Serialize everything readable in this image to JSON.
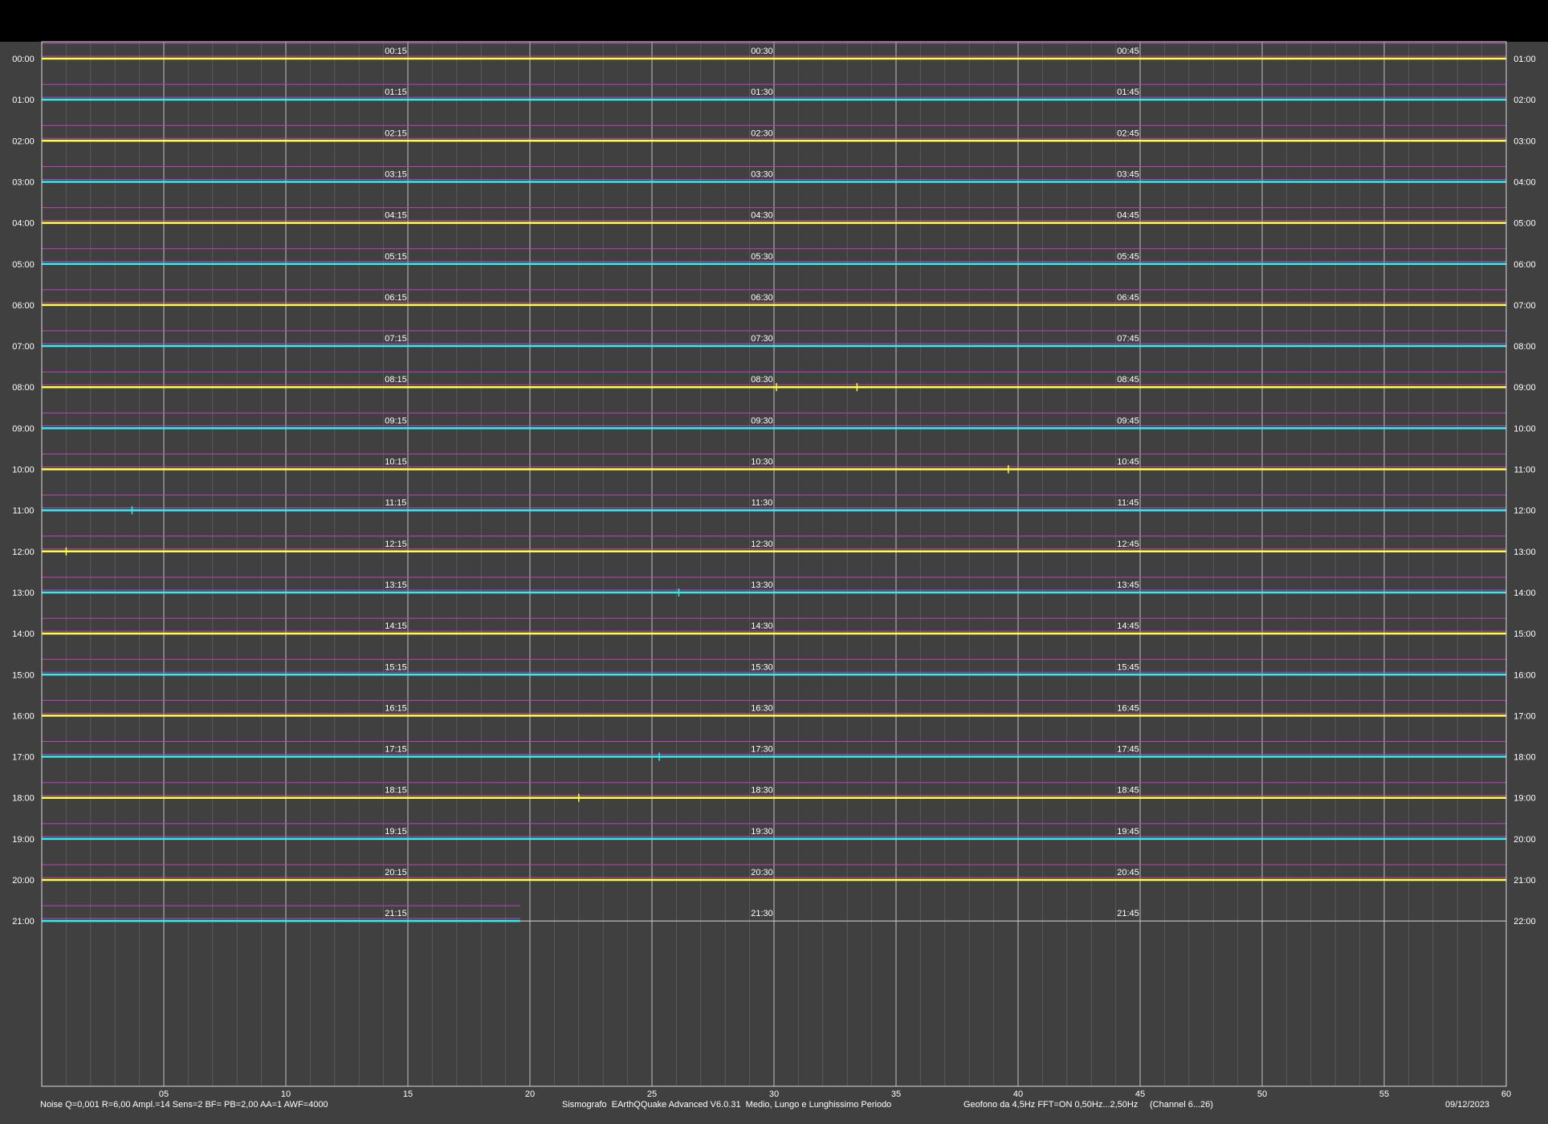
{
  "colors": {
    "background": "#404040",
    "top_bar": "#000000",
    "grid_minor": "#8a8a8a",
    "grid_major": "#d8d8d8",
    "magenta": "#c040c0",
    "trace_a": "#ffff3a",
    "trace_b": "#28f0f0",
    "text": "#ffffff"
  },
  "footer": {
    "left": "Noise Q=0,001 R=6,00 Ampl.=14 Sens=2 BF= PB=2,00 AA=1 AWF=4000",
    "center": "Sismografo  EArthQQuake Advanced V6.0.31  Medio, Lungo e Lunghissimo Periodo",
    "right_a": "Geofono da 4,5Hz FFT=ON 0,50Hz...2,50Hz",
    "right_b": "(Channel 6...26)",
    "date": "09/12/2023"
  },
  "chart_data": {
    "type": "line",
    "title": "",
    "xlabel": "",
    "ylabel": "",
    "x_range": [
      0,
      60
    ],
    "x_ticks": [
      "05",
      "10",
      "15",
      "20",
      "25",
      "30",
      "35",
      "40",
      "45",
      "50",
      "55",
      "60"
    ],
    "grid": true,
    "rows": [
      {
        "left": "00:00",
        "right": "01:00",
        "marks": [
          "00:15",
          "00:30",
          "00:45"
        ],
        "color": "yellow",
        "end_minute": 60
      },
      {
        "left": "01:00",
        "right": "02:00",
        "marks": [
          "01:15",
          "01:30",
          "01:45"
        ],
        "color": "cyan",
        "end_minute": 60
      },
      {
        "left": "02:00",
        "right": "03:00",
        "marks": [
          "02:15",
          "02:30",
          "02:45"
        ],
        "color": "yellow",
        "end_minute": 60
      },
      {
        "left": "03:00",
        "right": "04:00",
        "marks": [
          "03:15",
          "03:30",
          "03:45"
        ],
        "color": "cyan",
        "end_minute": 60
      },
      {
        "left": "04:00",
        "right": "05:00",
        "marks": [
          "04:15",
          "04:30",
          "04:45"
        ],
        "color": "yellow",
        "end_minute": 60
      },
      {
        "left": "05:00",
        "right": "06:00",
        "marks": [
          "05:15",
          "05:30",
          "05:45"
        ],
        "color": "cyan",
        "end_minute": 60
      },
      {
        "left": "06:00",
        "right": "07:00",
        "marks": [
          "06:15",
          "06:30",
          "06:45"
        ],
        "color": "yellow",
        "end_minute": 60
      },
      {
        "left": "07:00",
        "right": "08:00",
        "marks": [
          "07:15",
          "07:30",
          "07:45"
        ],
        "color": "cyan",
        "end_minute": 60
      },
      {
        "left": "08:00",
        "right": "09:00",
        "marks": [
          "08:15",
          "08:30",
          "08:45"
        ],
        "color": "yellow",
        "end_minute": 60
      },
      {
        "left": "09:00",
        "right": "10:00",
        "marks": [
          "09:15",
          "09:30",
          "09:45"
        ],
        "color": "cyan",
        "end_minute": 60
      },
      {
        "left": "10:00",
        "right": "11:00",
        "marks": [
          "10:15",
          "10:30",
          "10:45"
        ],
        "color": "yellow",
        "end_minute": 60
      },
      {
        "left": "11:00",
        "right": "12:00",
        "marks": [
          "11:15",
          "11:30",
          "11:45"
        ],
        "color": "cyan",
        "end_minute": 60
      },
      {
        "left": "12:00",
        "right": "13:00",
        "marks": [
          "12:15",
          "12:30",
          "12:45"
        ],
        "color": "yellow",
        "end_minute": 60
      },
      {
        "left": "13:00",
        "right": "14:00",
        "marks": [
          "13:15",
          "13:30",
          "13:45"
        ],
        "color": "cyan",
        "end_minute": 60
      },
      {
        "left": "14:00",
        "right": "15:00",
        "marks": [
          "14:15",
          "14:30",
          "14:45"
        ],
        "color": "yellow",
        "end_minute": 60
      },
      {
        "left": "15:00",
        "right": "16:00",
        "marks": [
          "15:15",
          "15:30",
          "15:45"
        ],
        "color": "cyan",
        "end_minute": 60
      },
      {
        "left": "16:00",
        "right": "17:00",
        "marks": [
          "16:15",
          "16:30",
          "16:45"
        ],
        "color": "yellow",
        "end_minute": 60
      },
      {
        "left": "17:00",
        "right": "18:00",
        "marks": [
          "17:15",
          "17:30",
          "17:45"
        ],
        "color": "cyan",
        "end_minute": 60
      },
      {
        "left": "18:00",
        "right": "19:00",
        "marks": [
          "18:15",
          "18:30",
          "18:45"
        ],
        "color": "yellow",
        "end_minute": 60
      },
      {
        "left": "19:00",
        "right": "20:00",
        "marks": [
          "19:15",
          "19:30",
          "19:45"
        ],
        "color": "cyan",
        "end_minute": 60
      },
      {
        "left": "20:00",
        "right": "21:00",
        "marks": [
          "20:15",
          "20:30",
          "20:45"
        ],
        "color": "yellow",
        "end_minute": 60
      },
      {
        "left": "21:00",
        "right": "22:00",
        "marks": [
          "21:15",
          "21:30",
          "21:45"
        ],
        "color": "cyan",
        "end_minute": 19.6
      }
    ],
    "events": [
      {
        "row": 8,
        "minute": 30.1
      },
      {
        "row": 8,
        "minute": 33.4
      },
      {
        "row": 10,
        "minute": 39.6
      },
      {
        "row": 11,
        "minute": 3.7
      },
      {
        "row": 12,
        "minute": 1.0
      },
      {
        "row": 13,
        "minute": 26.1
      },
      {
        "row": 17,
        "minute": 25.3
      },
      {
        "row": 18,
        "minute": 22.0
      }
    ]
  }
}
